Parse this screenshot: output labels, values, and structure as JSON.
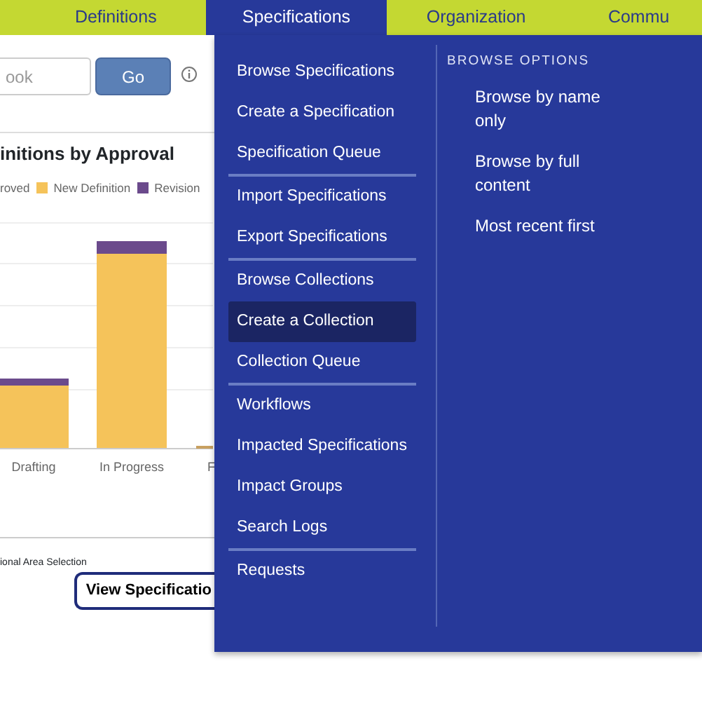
{
  "nav": {
    "tabs": [
      {
        "label": "Definitions",
        "selected": false
      },
      {
        "label": "Specifications",
        "selected": true
      },
      {
        "label": "Organization",
        "selected": false
      },
      {
        "label": "Commu",
        "selected": false
      }
    ]
  },
  "search": {
    "placeholder": "ook",
    "button": "Go"
  },
  "chart": {
    "title": "initions by Approval",
    "legend": [
      {
        "label": "roved"
      },
      {
        "label": "New Definition",
        "color": "#f5c35a"
      },
      {
        "label": "Revision",
        "color": "#6b4a8c"
      }
    ],
    "categories": [
      "Drafting",
      "In Progress",
      "F"
    ],
    "footer": "ional Area Selection"
  },
  "view_button": "View Specificatio",
  "dropdown": {
    "groups": [
      [
        {
          "label": "Browse Specifications",
          "selected": false
        },
        {
          "label": "Create a Specification",
          "selected": false
        },
        {
          "label": "Specification Queue",
          "selected": false
        }
      ],
      [
        {
          "label": "Import Specifications",
          "selected": false
        },
        {
          "label": "Export Specifications",
          "selected": false
        }
      ],
      [
        {
          "label": "Browse Collections",
          "selected": false
        },
        {
          "label": "Create a Collection",
          "selected": true
        },
        {
          "label": "Collection Queue",
          "selected": false
        }
      ],
      [
        {
          "label": "Workflows",
          "selected": false
        },
        {
          "label": "Impacted Specifications",
          "selected": false
        },
        {
          "label": "Impact Groups",
          "selected": false
        },
        {
          "label": "Search Logs",
          "selected": false
        }
      ],
      [
        {
          "label": "Requests",
          "selected": false
        }
      ]
    ],
    "options_heading": "BROWSE OPTIONS",
    "options": [
      "Browse by name only",
      "Browse by full content",
      "Most recent first"
    ]
  }
}
